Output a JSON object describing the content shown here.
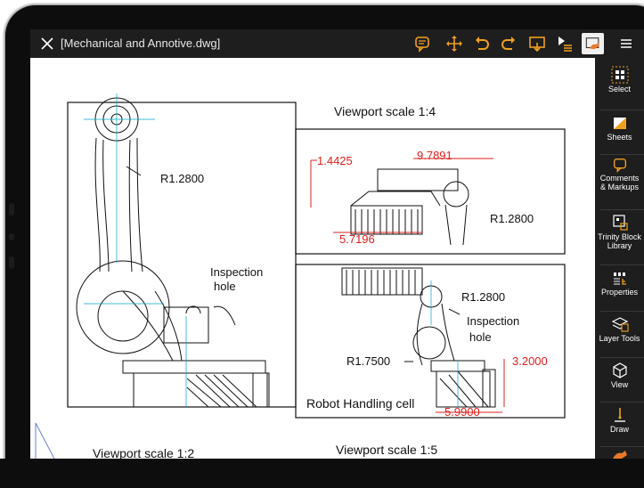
{
  "app": {
    "file_title": "[Mechanical and Annotive.dwg]"
  },
  "toolbar": {
    "icons": [
      "comment-icon",
      "move-icon",
      "undo-icon",
      "redo-icon",
      "screen-share-icon",
      "layers-play-icon",
      "markup-hand-icon",
      "menu-icon"
    ],
    "accent": "#f0a020"
  },
  "sidebar": {
    "items": [
      {
        "label": "Select",
        "icon": "select-grid-icon"
      },
      {
        "label": "Sheets",
        "icon": "sheets-icon"
      },
      {
        "label": "Comments\n& Markups",
        "icon": "comment-icon"
      },
      {
        "label": "Trinity Block\nLibrary",
        "icon": "block-library-icon"
      },
      {
        "label": "Properties",
        "icon": "properties-icon"
      },
      {
        "label": "Layer Tools",
        "icon": "layers-icon"
      },
      {
        "label": "View",
        "icon": "cube-icon"
      },
      {
        "label": "Draw",
        "icon": "draw-pen-icon"
      }
    ]
  },
  "drawing": {
    "vp_top_right": "Viewport scale 1:4",
    "vp_bottom_left": "Viewport scale 1:2",
    "vp_bottom_right": "Viewport scale 1:5",
    "left": {
      "radius": "R1.2800",
      "inspection_1": "Inspection",
      "inspection_2": "hole"
    },
    "top_right": {
      "dim_a": "1.4425",
      "dim_b": "9.7891",
      "dim_c": "5.7196",
      "radius": "R1.2800"
    },
    "bottom_right": {
      "radius_a": "R1.2800",
      "inspection_1": "Inspection",
      "inspection_2": "hole",
      "radius_b": "R1.7500",
      "dim_a": "3.2000",
      "dim_b": "5.9900",
      "caption": "Robot Handling cell"
    }
  }
}
